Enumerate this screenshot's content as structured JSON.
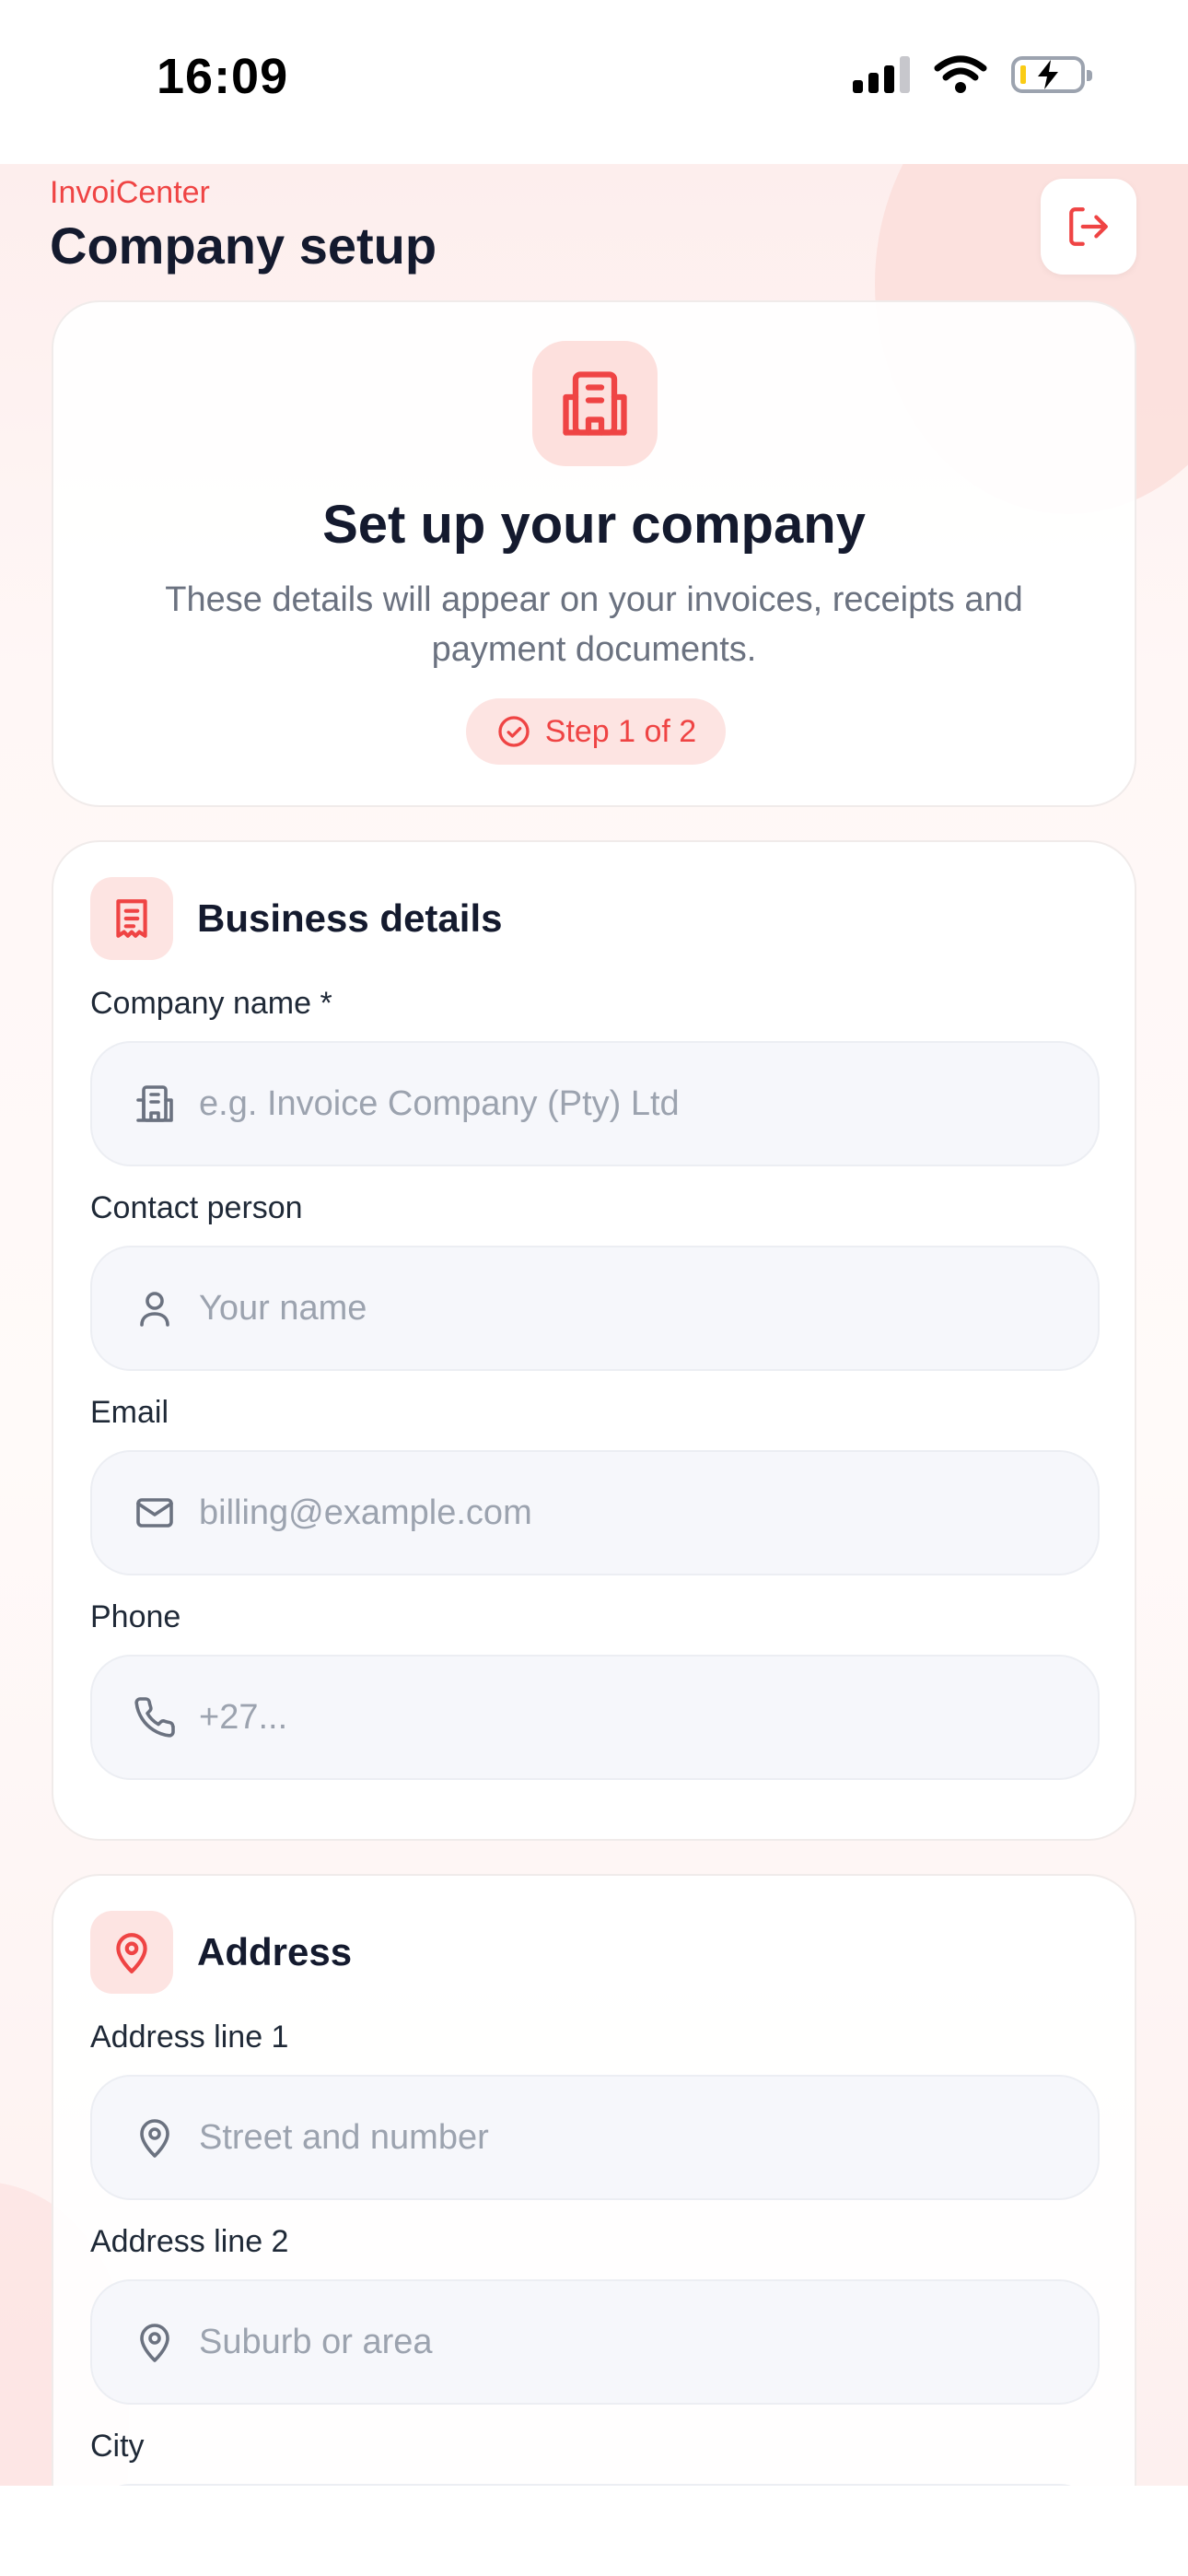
{
  "status_bar": {
    "time": "16:09"
  },
  "header": {
    "brand": "InvoiCenter",
    "title": "Company setup"
  },
  "hero": {
    "title": "Set up your company",
    "description": "These details will appear on your invoices, receipts and payment documents.",
    "step": "Step 1 of 2"
  },
  "business": {
    "title": "Business details",
    "company_name": {
      "label": "Company name *",
      "placeholder": "e.g. Invoice Company (Pty) Ltd"
    },
    "contact_person": {
      "label": "Contact person",
      "placeholder": "Your name"
    },
    "email": {
      "label": "Email",
      "placeholder": "billing@example.com"
    },
    "phone": {
      "label": "Phone",
      "placeholder": "+27..."
    }
  },
  "address": {
    "title": "Address",
    "line1": {
      "label": "Address line 1",
      "placeholder": "Street and number"
    },
    "line2": {
      "label": "Address line 2",
      "placeholder": "Suburb or area"
    },
    "city": {
      "label": "City",
      "placeholder": ""
    }
  },
  "colors": {
    "accent": "#ef4444",
    "accent_soft": "#fde4e2",
    "title": "#141a2e",
    "muted": "#6b7280"
  }
}
